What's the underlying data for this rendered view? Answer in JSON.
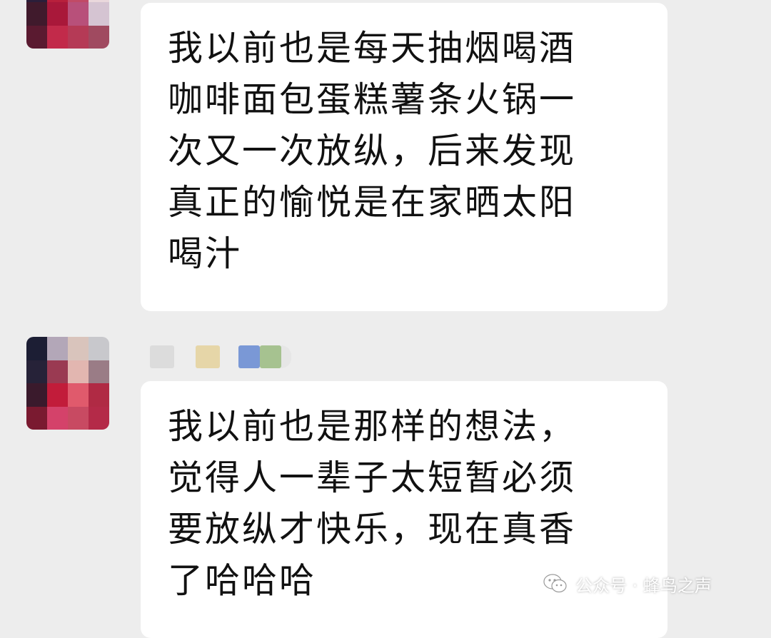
{
  "messages": [
    {
      "lines": [
        "我以前也是每天抽烟喝酒",
        "咖啡面包蛋糕薯条火锅一",
        "次又一次放纵，后来发现",
        "真正的愉悦是在家晒太阳",
        "喝汁"
      ]
    },
    {
      "lines": [
        "我以前也是那样的想法，",
        "觉得人一辈子太短暂必须",
        "要放纵才快乐，现在真香",
        "了哈哈哈"
      ]
    }
  ],
  "watermark": {
    "icon": "wechat-icon",
    "text": "公众号 · 蜂鸟之声"
  },
  "colors": {
    "background": "#ededed",
    "bubble": "#ffffff",
    "text": "#111111"
  }
}
